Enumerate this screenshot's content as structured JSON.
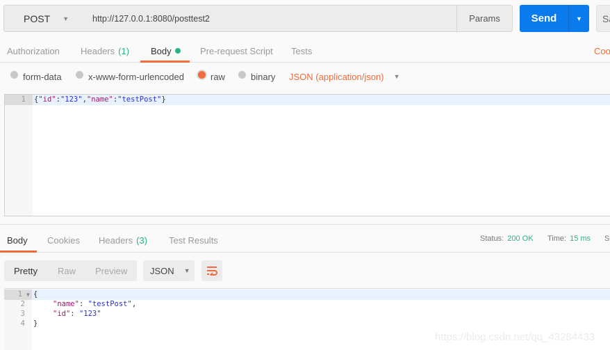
{
  "request": {
    "method": "POST",
    "url": "http://127.0.0.1:8080/posttest2",
    "params_label": "Params",
    "send_label": "Send",
    "save_label": "Sa"
  },
  "request_tabs": [
    {
      "label": "Authorization"
    },
    {
      "label": "Headers",
      "count": "(1)"
    },
    {
      "label": "Body",
      "active": true,
      "has_dot": true
    },
    {
      "label": "Pre-request Script"
    },
    {
      "label": "Tests"
    }
  ],
  "cookies_label": "Coo",
  "body_types": [
    {
      "label": "form-data",
      "selected": false
    },
    {
      "label": "x-www-form-urlencoded",
      "selected": false
    },
    {
      "label": "raw",
      "selected": true
    },
    {
      "label": "binary",
      "selected": false
    }
  ],
  "content_type": "JSON (application/json)",
  "request_body": {
    "lines": [
      {
        "number": "1",
        "text": "{\"id\":\"123\",\"name\":\"testPost\"}"
      }
    ]
  },
  "response_tabs": [
    {
      "label": "Body",
      "active": true
    },
    {
      "label": "Cookies"
    },
    {
      "label": "Headers",
      "count": "(3)"
    },
    {
      "label": "Test Results"
    }
  ],
  "response_status": {
    "status_label": "Status:",
    "status_value": "200 OK",
    "time_label": "Time:",
    "time_value": "15 ms",
    "size_label": "Si"
  },
  "response_view": {
    "modes": [
      "Pretty",
      "Raw",
      "Preview"
    ],
    "active_mode": "Pretty",
    "format": "JSON"
  },
  "response_body": {
    "lines": [
      {
        "number": "1",
        "text": "{"
      },
      {
        "number": "2",
        "key": "\"name\"",
        "value": "\"testPost\"",
        "trail": ","
      },
      {
        "number": "3",
        "key": "\"id\"",
        "value": "\"123\"",
        "trail": ""
      },
      {
        "number": "4",
        "text": "}"
      }
    ]
  },
  "watermark": "https://blog.csdn.net/qq_43284433",
  "colors": {
    "accent": "#f26b3a",
    "send": "#097bed",
    "success": "#26b47f"
  }
}
